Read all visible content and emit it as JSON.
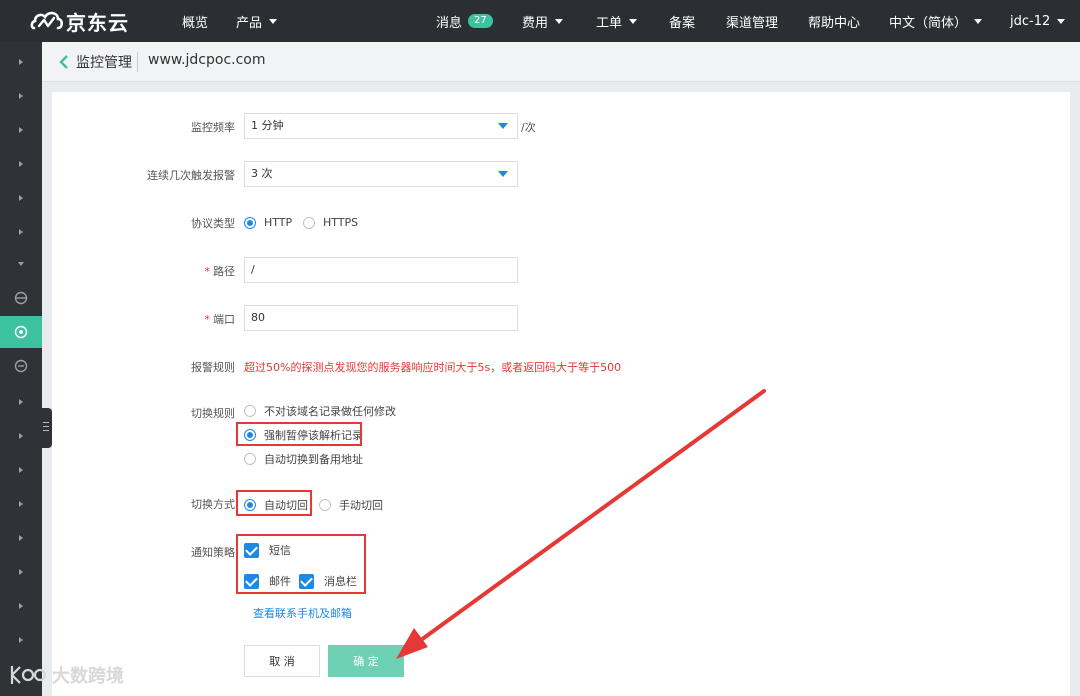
{
  "brand": {
    "name": "京东云"
  },
  "topnav": {
    "overview": "概览",
    "products": "产品",
    "messages": "消息",
    "messages_count": "27",
    "billing": "费用",
    "tickets": "工单",
    "filing": "备案",
    "channel": "渠道管理",
    "help": "帮助中心",
    "language": "中文（简体）",
    "user": "jdc-12"
  },
  "header": {
    "breadcrumb": "监控管理",
    "domain": "www.jdcpoc.com"
  },
  "form": {
    "frequency": {
      "label": "监控频率",
      "value": "1 分钟",
      "suffix": "/次"
    },
    "trigger": {
      "label": "连续几次触发报警",
      "value": "3 次"
    },
    "protocol": {
      "label": "协议类型",
      "options": [
        "HTTP",
        "HTTPS"
      ],
      "selected": "HTTP"
    },
    "path": {
      "label": "路径",
      "value": "/"
    },
    "port": {
      "label": "端口",
      "value": "80"
    },
    "alarm_rule": {
      "label": "报警规则",
      "text": "超过50%的探测点发现您的服务器响应时间大于5s，或者返回码大于等于500"
    },
    "switch_rule": {
      "label": "切换规则",
      "options": [
        "不对该域名记录做任何修改",
        "强制暂停该解析记录",
        "自动切换到备用地址"
      ],
      "selected": "强制暂停该解析记录"
    },
    "switch_mode": {
      "label": "切换方式",
      "options": [
        "自动切回",
        "手动切回"
      ],
      "selected": "自动切回"
    },
    "notify": {
      "label": "通知策略",
      "options": [
        "短信",
        "邮件",
        "消息栏"
      ],
      "checked": [
        "短信",
        "邮件",
        "消息栏"
      ]
    },
    "contact_link": "查看联系手机及邮箱",
    "cancel": "取 消",
    "confirm": "确 定"
  },
  "watermark": "大数跨境",
  "colors": {
    "accent": "#1e88e5",
    "brand_green": "#3cc29e",
    "highlight": "#e53935",
    "topbar": "#2b2f33"
  }
}
